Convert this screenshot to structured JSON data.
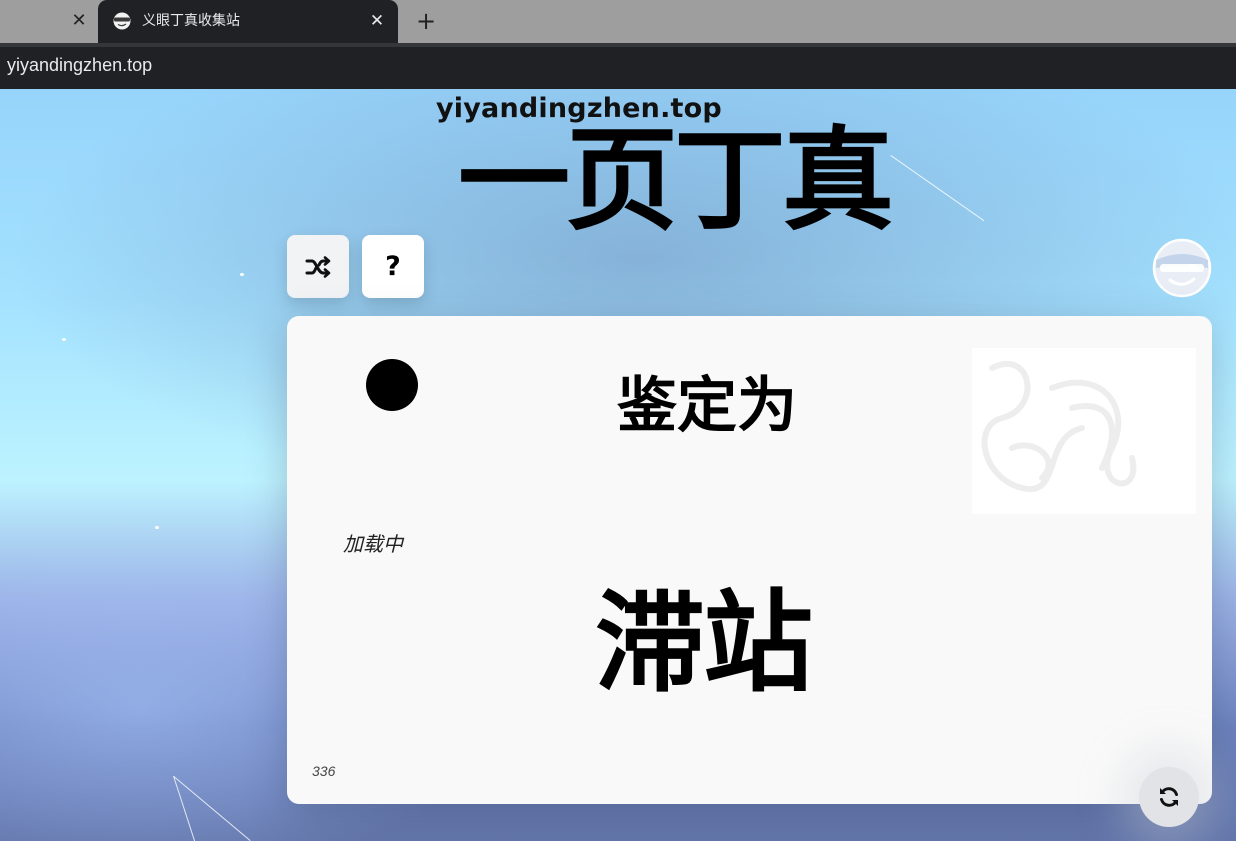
{
  "browser": {
    "tab_title": "义眼丁真收集站",
    "url": "yiyandingzhen.top",
    "icons": {
      "previous_tab_close": "close-icon",
      "tab_close": "close-icon",
      "new_tab": "plus-icon",
      "favicon": "dingzhen-face-icon"
    },
    "glyphs": {
      "close": "✕",
      "plus": "+"
    }
  },
  "page": {
    "domain_heading": "yiyandingzhen.top",
    "title": "一页丁真",
    "buttons": {
      "shuffle_icon": "shuffle-icon",
      "help_label": "?",
      "refresh_icon": "refresh-icon"
    },
    "logo_icon": "dingzhen-face-icon"
  },
  "card": {
    "heading": "鉴定为",
    "loading_text": "加载中",
    "result": "滞站",
    "count": "336"
  },
  "colors": {
    "sky_top": "#97d4fb",
    "sky_mid": "#bdf3ff",
    "sky_bottom": "#6376ab",
    "card_bg": "#f9f9f9",
    "chrome_dark": "#202124",
    "chrome_tabbar": "#9e9e9e"
  }
}
